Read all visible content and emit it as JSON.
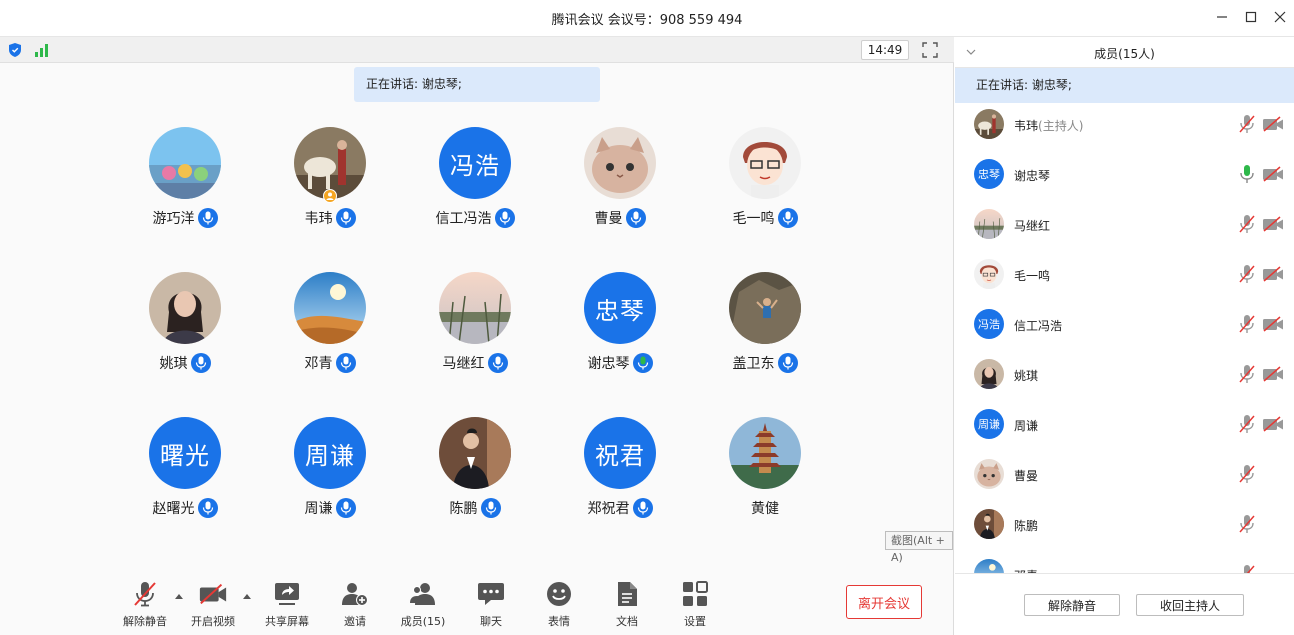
{
  "window": {
    "title": "腾讯会议 会议号：908 559 494",
    "controls": [
      "minimize-icon",
      "maximize-icon",
      "close-icon"
    ]
  },
  "meeting": {
    "clock": "14:49",
    "speaking_label": "正在讲话: 谢忠琴;",
    "colors": {
      "accent": "#1a73e8",
      "speaking_bg": "#dbe9fb",
      "leave": "#e53935",
      "mic_active": "#2eb84a"
    }
  },
  "participants": [
    {
      "name": "游巧洋",
      "avatar_text": "",
      "avatar": "photo-crowd",
      "mic": "active"
    },
    {
      "name": "韦玮",
      "avatar_text": "",
      "avatar": "photo-horse",
      "mic": "active",
      "host": true
    },
    {
      "name": "信工冯浩",
      "avatar_text": "冯浩",
      "avatar": "text",
      "mic": "active"
    },
    {
      "name": "曹曼",
      "avatar_text": "",
      "avatar": "photo-cat",
      "mic": "active"
    },
    {
      "name": "毛一鸣",
      "avatar_text": "",
      "avatar": "photo-cartoon",
      "mic": "active"
    },
    {
      "name": "姚琪",
      "avatar_text": "",
      "avatar": "photo-woman",
      "mic": "active"
    },
    {
      "name": "邓青",
      "avatar_text": "",
      "avatar": "photo-desert",
      "mic": "active"
    },
    {
      "name": "马继红",
      "avatar_text": "",
      "avatar": "photo-lake",
      "mic": "active"
    },
    {
      "name": "谢忠琴",
      "avatar_text": "忠琴",
      "avatar": "text",
      "mic": "speaking"
    },
    {
      "name": "盖卫东",
      "avatar_text": "",
      "avatar": "photo-rock",
      "mic": "active"
    },
    {
      "name": "赵曙光",
      "avatar_text": "曙光",
      "avatar": "text",
      "mic": "active"
    },
    {
      "name": "周谦",
      "avatar_text": "周谦",
      "avatar": "text",
      "mic": "active"
    },
    {
      "name": "陈鹏",
      "avatar_text": "",
      "avatar": "photo-suit",
      "mic": "active"
    },
    {
      "name": "郑祝君",
      "avatar_text": "祝君",
      "avatar": "text",
      "mic": "active"
    },
    {
      "name": "黄健",
      "avatar_text": "",
      "avatar": "photo-pagoda",
      "mic": "none"
    }
  ],
  "tooltip": "截图(Alt + A)",
  "toolbar": {
    "unmute": "解除静音",
    "start_video": "开启视频",
    "share_screen": "共享屏幕",
    "invite": "邀请",
    "members": "成员(15)",
    "chat": "聊天",
    "reactions": "表情",
    "docs": "文档",
    "settings": "设置",
    "leave": "离开会议"
  },
  "panel": {
    "title": "成员(15人)",
    "speaking_label": "正在讲话: 谢忠琴;",
    "members": [
      {
        "name": "韦玮",
        "role": "(主持人)",
        "avatar_text": "",
        "avatar": "photo-horse",
        "mic": "muted",
        "cam": "off"
      },
      {
        "name": "谢忠琴",
        "role": "",
        "avatar_text": "忠琴",
        "avatar": "text",
        "mic": "speaking",
        "cam": "off"
      },
      {
        "name": "马继红",
        "role": "",
        "avatar_text": "",
        "avatar": "photo-lake",
        "mic": "muted",
        "cam": "off"
      },
      {
        "name": "毛一鸣",
        "role": "",
        "avatar_text": "",
        "avatar": "photo-cartoon",
        "mic": "muted",
        "cam": "off"
      },
      {
        "name": "信工冯浩",
        "role": "",
        "avatar_text": "冯浩",
        "avatar": "text",
        "mic": "muted",
        "cam": "off"
      },
      {
        "name": "姚琪",
        "role": "",
        "avatar_text": "",
        "avatar": "photo-woman",
        "mic": "muted",
        "cam": "off"
      },
      {
        "name": "周谦",
        "role": "",
        "avatar_text": "周谦",
        "avatar": "text",
        "mic": "muted",
        "cam": "off"
      },
      {
        "name": "曹曼",
        "role": "",
        "avatar_text": "",
        "avatar": "photo-cat",
        "mic": "muted",
        "cam": "none"
      },
      {
        "name": "陈鹏",
        "role": "",
        "avatar_text": "",
        "avatar": "photo-suit",
        "mic": "muted",
        "cam": "none"
      },
      {
        "name": "邓青",
        "role": "",
        "avatar_text": "",
        "avatar": "photo-desert",
        "mic": "muted",
        "cam": "none"
      }
    ],
    "mute_all": "解除静音",
    "reclaim_host": "收回主持人"
  }
}
